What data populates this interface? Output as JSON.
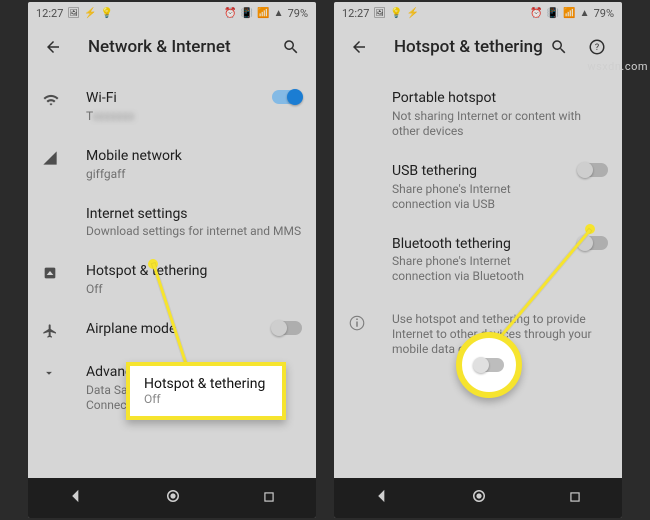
{
  "status": {
    "time": "12:27",
    "battery": "79%",
    "icons_left": [
      "image-icon",
      "bolt-icon",
      "lightbulb-icon"
    ],
    "icons_right": [
      "alarm-icon",
      "vibrate-icon",
      "wifi-weak-icon",
      "signal-icon"
    ]
  },
  "left": {
    "title": "Network & Internet",
    "items": [
      {
        "icon": "wifi",
        "title": "Wi-Fi",
        "sub": "T",
        "toggle": "on"
      },
      {
        "icon": "signal",
        "title": "Mobile network",
        "sub": "giffgaff"
      },
      {
        "icon": "",
        "title": "Internet settings",
        "sub": "Download settings for internet and MMS"
      },
      {
        "icon": "hotspot",
        "title": "Hotspot & tethering",
        "sub": "Off"
      },
      {
        "icon": "plane",
        "title": "Airplane mode",
        "sub": "",
        "toggle": "off"
      },
      {
        "icon": "chevron",
        "title": "Advanced",
        "sub": "Data Saver, VPN, Private DNS, Connection…"
      }
    ],
    "callout": {
      "title": "Hotspot & tethering",
      "sub": "Off"
    }
  },
  "right": {
    "title": "Hotspot & tethering",
    "items": [
      {
        "title": "Portable hotspot",
        "sub": "Not sharing Internet or content with other devices"
      },
      {
        "title": "USB tethering",
        "sub": "Share phone's Internet connection via USB",
        "toggle": "off"
      },
      {
        "title": "Bluetooth tethering",
        "sub": "Share phone's Internet connection via Bluetooth",
        "toggle": "off"
      }
    ],
    "info": "Use hotspot and tethering to provide Internet to other devices through your mobile data connection."
  },
  "nav": [
    "back",
    "home",
    "recent"
  ],
  "watermark": "wsxdn.com"
}
